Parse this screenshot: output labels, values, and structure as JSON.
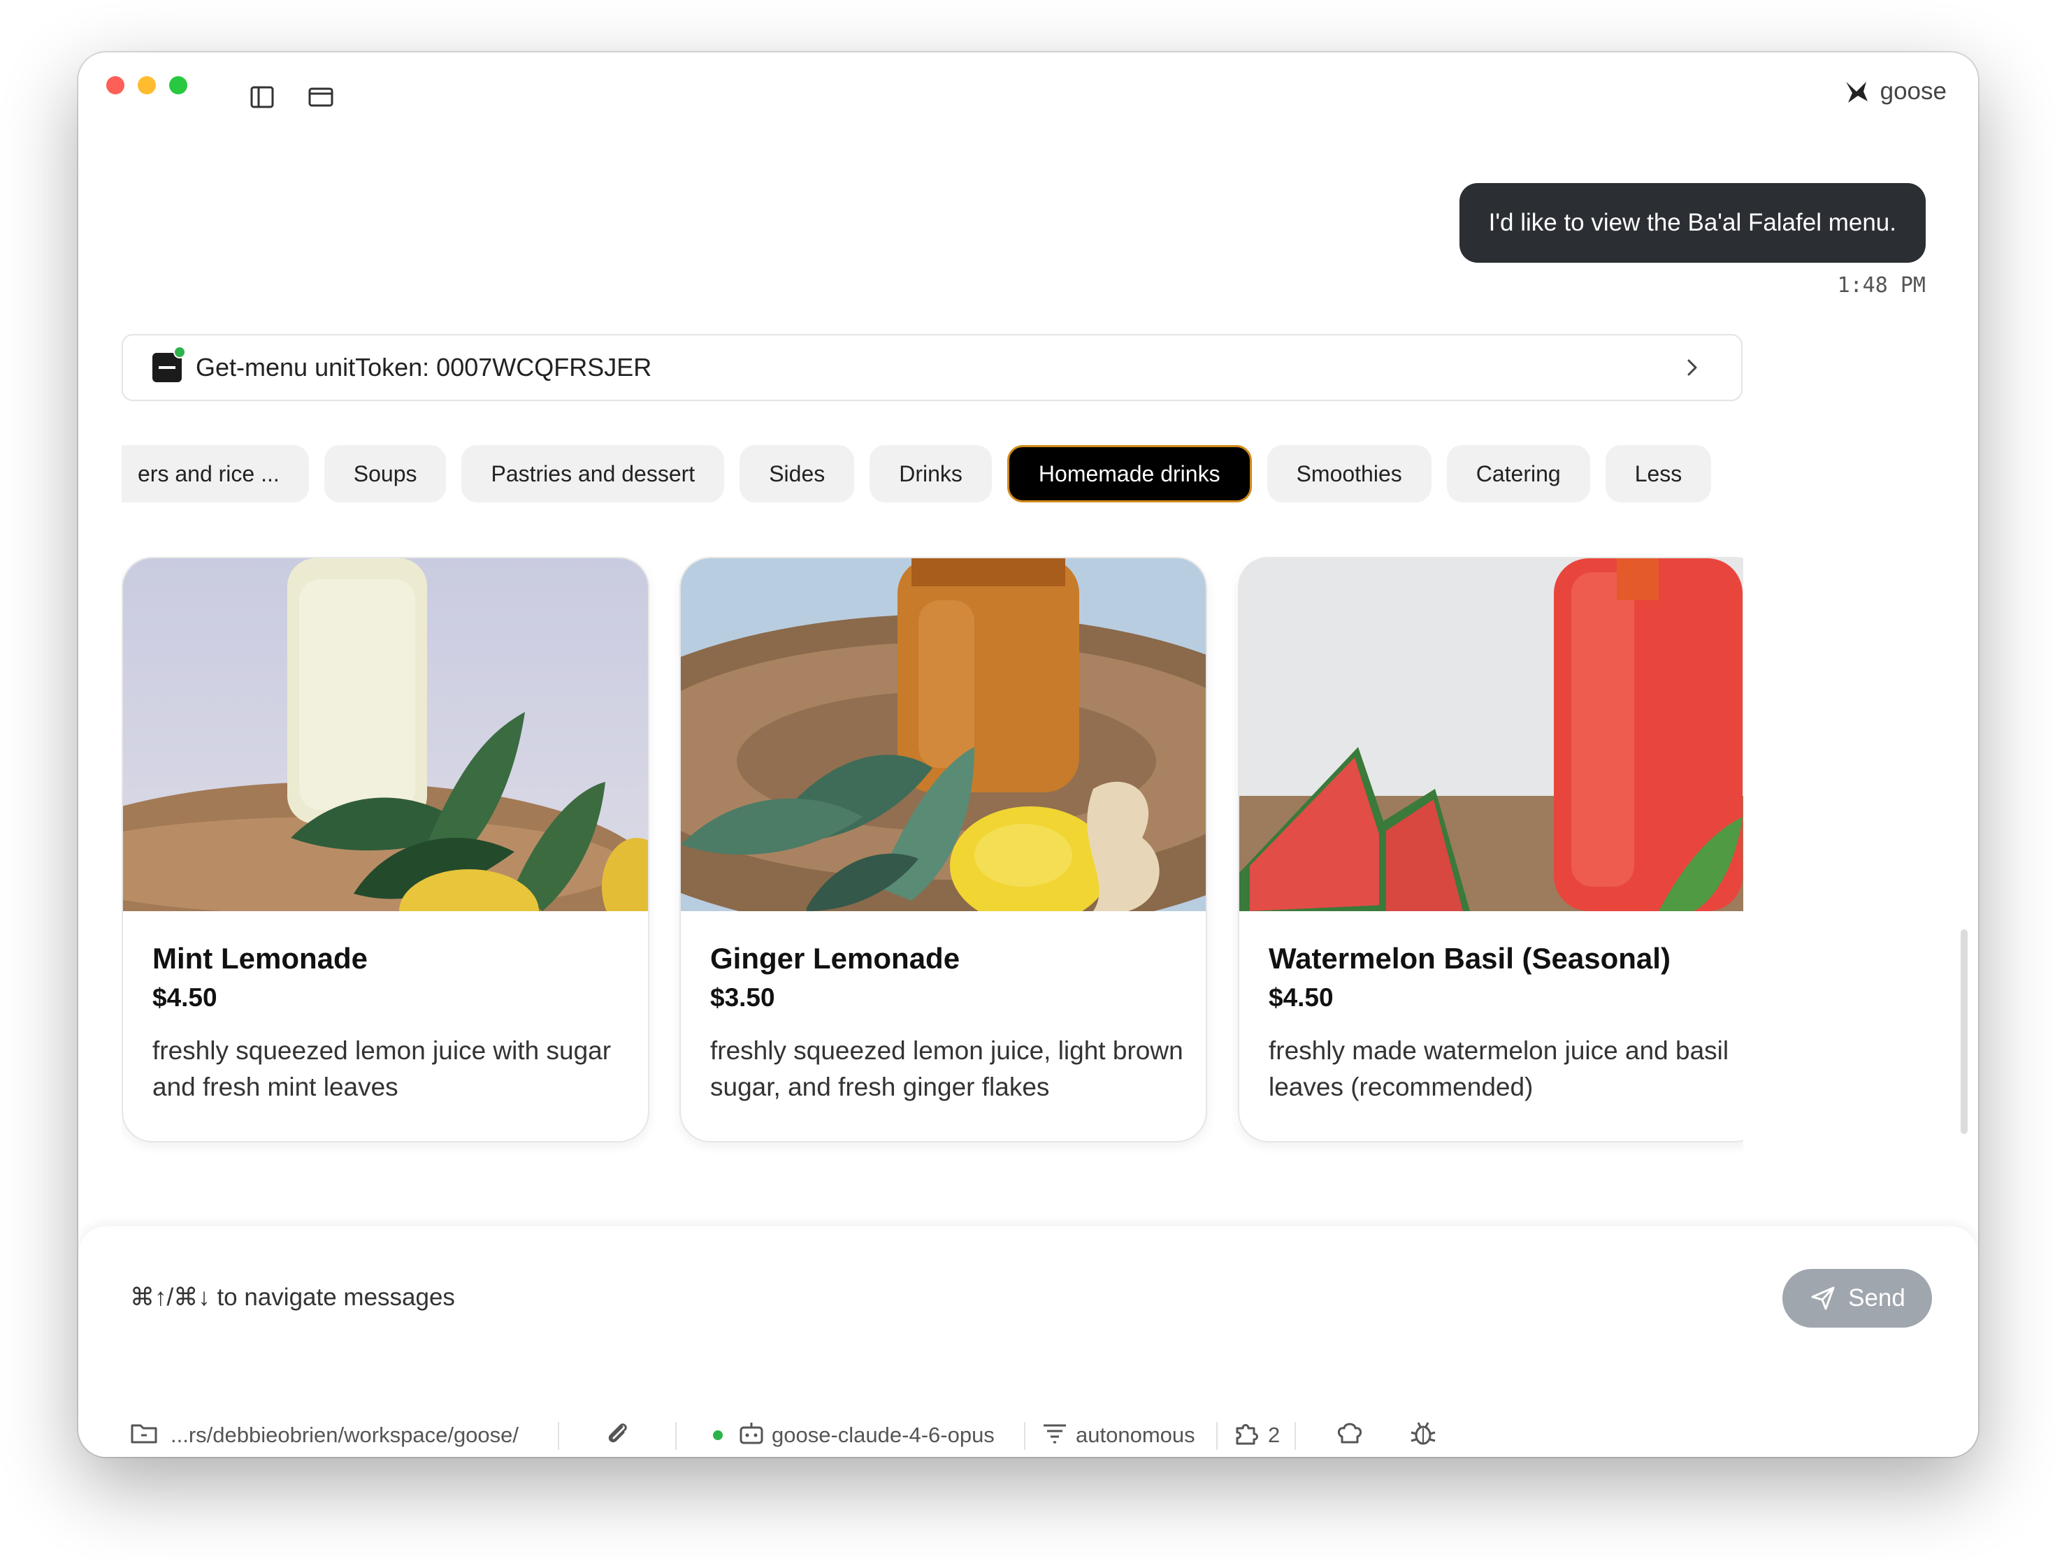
{
  "window": {
    "brand_name": "goose"
  },
  "titlebar": {
    "icons": [
      "sidebar-toggle-icon",
      "window-icon"
    ]
  },
  "conversation": {
    "user_message": "I'd like to view the Ba'al Falafel menu.",
    "timestamp": "1:48 PM",
    "tool_call": {
      "label": "Get-menu unitToken: 0007WCQFRSJER",
      "status_color": "#2db34a"
    }
  },
  "menu": {
    "categories": [
      {
        "label": "ers and rice ...",
        "active": false
      },
      {
        "label": "Soups",
        "active": false
      },
      {
        "label": "Pastries and dessert",
        "active": false
      },
      {
        "label": "Sides",
        "active": false
      },
      {
        "label": "Drinks",
        "active": false
      },
      {
        "label": "Homemade drinks",
        "active": true
      },
      {
        "label": "Smoothies",
        "active": false
      },
      {
        "label": "Catering",
        "active": false
      },
      {
        "label": "Less",
        "active": false
      }
    ],
    "items": [
      {
        "name": "Mint Lemonade",
        "price": "$4.50",
        "description": "freshly squeezed lemon juice with sugar and fresh mint leaves"
      },
      {
        "name": "Ginger Lemonade",
        "price": "$3.50",
        "description": "freshly squeezed lemon juice, light brown sugar, and fresh ginger flakes"
      },
      {
        "name": "Watermelon Basil (Seasonal)",
        "price": "$4.50",
        "description": "freshly made watermelon juice and basil leaves (recommended)"
      }
    ]
  },
  "composer": {
    "placeholder": "⌘↑/⌘↓ to navigate messages",
    "send_label": "Send",
    "footer": {
      "path": "...rs/debbieobrien/workspace/goose/",
      "model": "goose-claude-4-6-opus",
      "mode": "autonomous",
      "extensions_count": "2"
    }
  },
  "colors": {
    "accent_active_border": "#d08a1a",
    "bubble_bg": "#2b2f33",
    "send_bg": "#9fa6ad"
  }
}
